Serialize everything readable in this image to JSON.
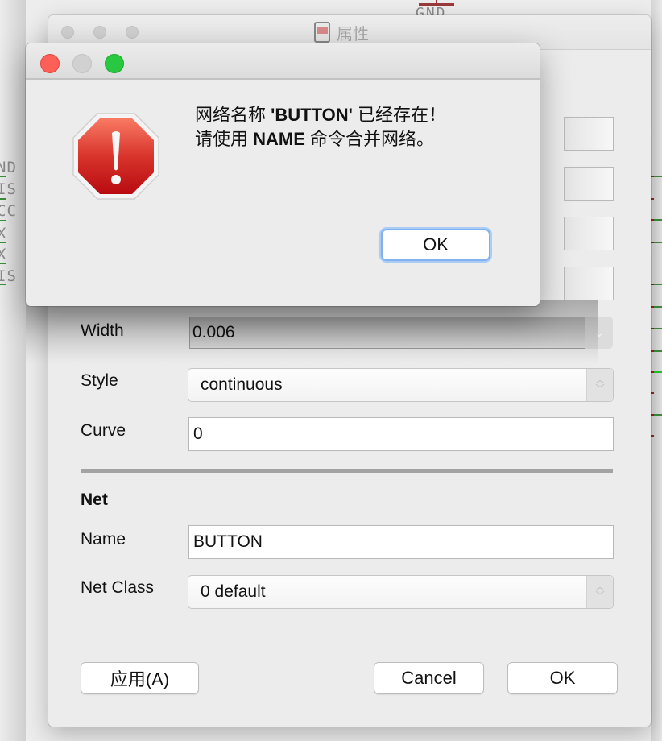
{
  "background": {
    "left_labels": [
      "ND",
      "IS",
      "CC",
      "X",
      "X",
      "IS"
    ],
    "top_label": "GND",
    "wire_colors": {
      "green": "#3a8f3a",
      "red": "#8b2a2a"
    }
  },
  "properties_window": {
    "title": "属性",
    "title_icon": "schematic-sch-icon",
    "fields": {
      "width": {
        "label": "Width",
        "value": "0.006"
      },
      "style": {
        "label": "Style",
        "value": "continuous"
      },
      "curve": {
        "label": "Curve",
        "value": "0"
      }
    },
    "net_section": {
      "title": "Net",
      "name": {
        "label": "Name",
        "value": "BUTTON"
      },
      "net_class": {
        "label": "Net Class",
        "value": "0 default"
      }
    },
    "buttons": {
      "apply": "应用(A)",
      "cancel": "Cancel",
      "ok": "OK"
    }
  },
  "alert_dialog": {
    "icon": "stop-icon",
    "message_line1": {
      "prefix": "网络名称 ",
      "name": "'BUTTON'",
      "suffix": " 已经存在！"
    },
    "message_line2": {
      "prefix": "请使用 ",
      "command": "NAME",
      "suffix": " 命令合并网络。"
    },
    "ok_label": "OK",
    "colors": {
      "close": "#fe5f57",
      "minimize": "#d1d1d1",
      "zoom": "#28c840",
      "default_button_focus": "#7fb2ee"
    }
  }
}
